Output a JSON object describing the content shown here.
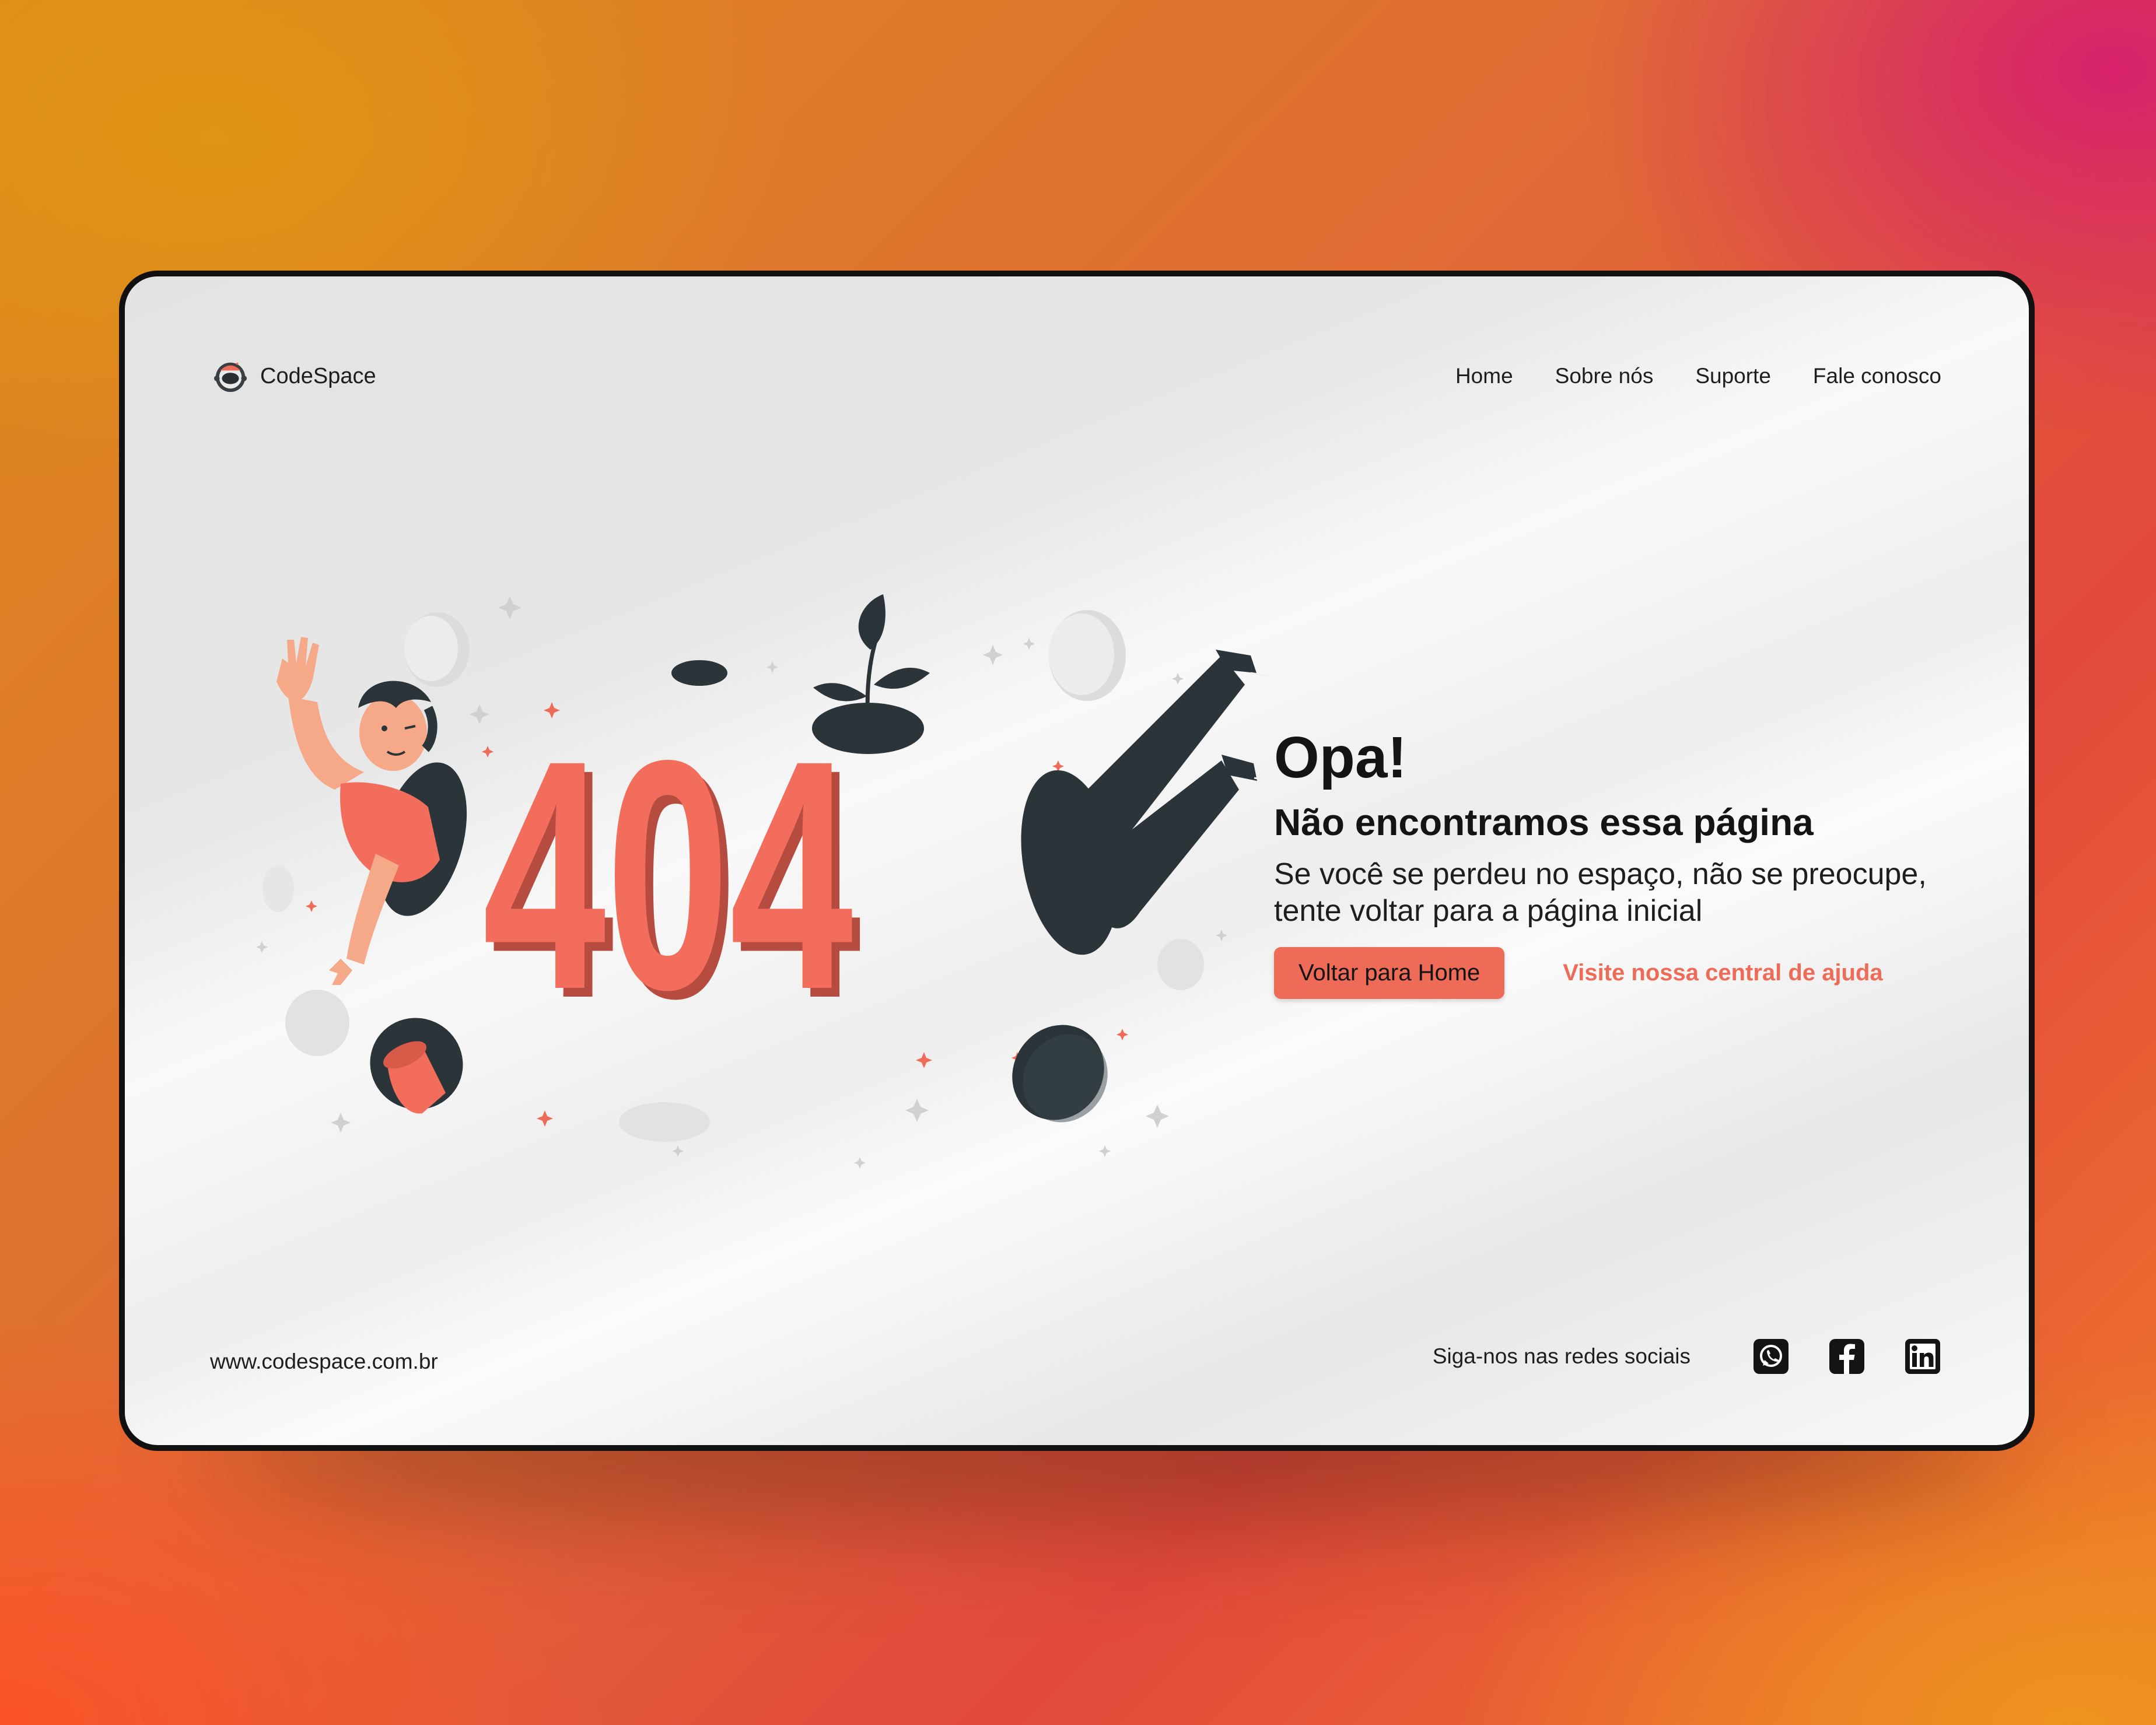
{
  "brand": {
    "name": "CodeSpace",
    "logo_icon": "astronaut-helmet-icon"
  },
  "nav": {
    "items": [
      {
        "label": "Home"
      },
      {
        "label": "Sobre nós"
      },
      {
        "label": "Suporte"
      },
      {
        "label": "Fale conosco"
      }
    ]
  },
  "illustration": {
    "error_code": "404",
    "description_icon": "person-falling-through-holes-illustration"
  },
  "main": {
    "title": "Opa!",
    "subtitle": "Não encontramos essa página",
    "description": "Se você se perdeu no espaço, não se preocupe, tente voltar para a página inicial",
    "primary_button": "Voltar para Home",
    "secondary_link": "Visite nossa central de ajuda"
  },
  "footer": {
    "url": "www.codespace.com.br",
    "social_label": "Siga-nos nas redes sociais",
    "social_icons": [
      "whatsapp-icon",
      "facebook-icon",
      "linkedin-icon"
    ]
  },
  "colors": {
    "accent": "#ee6b57",
    "dark": "#2a3439",
    "text": "#141414"
  }
}
